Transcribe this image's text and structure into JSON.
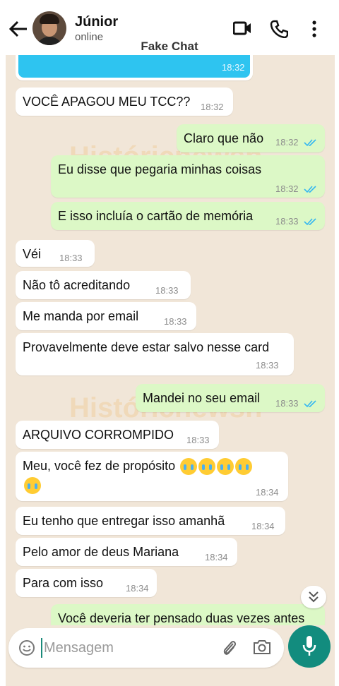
{
  "header": {
    "contact_name": "Júnior",
    "status": "online",
    "title_overlay": "Fake Chat"
  },
  "watermark": "Históricnewsh",
  "colors": {
    "incoming_bubble": "#ffffff",
    "outgoing_bubble": "#dcf8c6",
    "read_ticks": "#34b7f1",
    "accent": "#128c7e"
  },
  "messages": [
    {
      "direction": "out",
      "text": "",
      "time": "18:32",
      "note": "blue media preview"
    },
    {
      "direction": "in",
      "text": "VOCÊ APAGOU MEU TCC??",
      "time": "18:32"
    },
    {
      "direction": "out",
      "text": "Claro que não",
      "time": "18:32"
    },
    {
      "direction": "out",
      "text": "Eu disse que pegaria minhas coisas",
      "time": "18:32"
    },
    {
      "direction": "out",
      "text": "E isso incluía o cartão de memória",
      "time": "18:33"
    },
    {
      "direction": "in",
      "text": "Véi",
      "time": "18:33"
    },
    {
      "direction": "in",
      "text": "Não tô acreditando",
      "time": "18:33"
    },
    {
      "direction": "in",
      "text": "Me manda por email",
      "time": "18:33"
    },
    {
      "direction": "in",
      "text": "Provavelmente deve estar salvo nesse card",
      "time": "18:33"
    },
    {
      "direction": "out",
      "text": "Mandei no seu email",
      "time": "18:33"
    },
    {
      "direction": "in",
      "text": "ARQUIVO CORROMPIDO",
      "time": "18:33"
    },
    {
      "direction": "in",
      "text": "Meu, você fez de propósito",
      "time": "18:34",
      "emoji": "crying-face x5"
    },
    {
      "direction": "in",
      "text": "Eu tenho que entregar isso amanhã",
      "time": "18:34"
    },
    {
      "direction": "in",
      "text": "Pelo amor de deus Mariana",
      "time": "18:34"
    },
    {
      "direction": "in",
      "text": "Para com isso",
      "time": "18:34"
    },
    {
      "direction": "out",
      "text": "Você deveria ter pensado duas vezes antes",
      "time": ""
    }
  ],
  "composer": {
    "placeholder": "Mensagem",
    "icons": [
      "emoji-icon",
      "attach-icon",
      "camera-icon",
      "mic-icon"
    ]
  }
}
